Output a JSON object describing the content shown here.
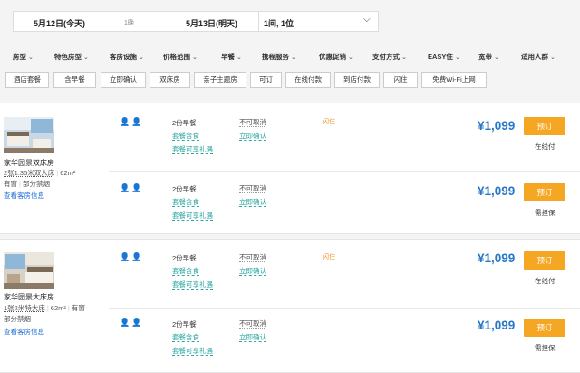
{
  "search": {
    "checkin": "5月12日(今天)",
    "nights": "1晚",
    "checkout": "5月13日(明天)",
    "rooms_guests": "1间, 1位"
  },
  "filters": [
    "房型",
    "特色房型",
    "客房设施",
    "价格范围",
    "早餐",
    "携程服务",
    "优惠促销",
    "支付方式",
    "EASY住",
    "宽带",
    "适用人群"
  ],
  "tags": [
    "酒店套餐",
    "含早餐",
    "立即确认",
    "双床房",
    "亲子主题房",
    "可订",
    "在线付款",
    "到店付款",
    "闪住",
    "免费Wi-Fi上网"
  ],
  "rooms": [
    {
      "name": "家华园景双床房",
      "line1": [
        "2张1.35米双人床",
        "62m²"
      ],
      "line2": [
        "有窗",
        "部分禁烟"
      ],
      "link": "查看客房信息",
      "plans": [
        {
          "guests": "2",
          "breakfast": "2份早餐",
          "pkg1": "套餐含食",
          "pkg2": "套餐可享礼遇",
          "cancel": "不可取消",
          "confirm": "立即确认",
          "flash": "闪住",
          "price": "¥1,099",
          "book": "预订",
          "pay": "在线付"
        },
        {
          "guests": "2",
          "breakfast": "2份早餐",
          "pkg1": "套餐含食",
          "pkg2": "套餐可享礼遇",
          "cancel": "不可取消",
          "confirm": "立即确认",
          "flash": "",
          "price": "¥1,099",
          "book": "预订",
          "pay": "需担保"
        }
      ]
    },
    {
      "name": "家华园景大床房",
      "line1": [
        "1张2米特大床",
        "62m²",
        "有窗"
      ],
      "line2": [
        "部分禁烟"
      ],
      "link": "查看客房信息",
      "plans": [
        {
          "guests": "2",
          "breakfast": "2份早餐",
          "pkg1": "套餐含食",
          "pkg2": "套餐可享礼遇",
          "cancel": "不可取消",
          "confirm": "立即确认",
          "flash": "闪住",
          "price": "¥1,099",
          "book": "预订",
          "pay": "在线付"
        },
        {
          "guests": "2",
          "breakfast": "2份早餐",
          "pkg1": "套餐含食",
          "pkg2": "套餐可享礼遇",
          "cancel": "不可取消",
          "confirm": "立即确认",
          "flash": "",
          "price": "¥1,099",
          "book": "预订",
          "pay": "需担保"
        }
      ]
    }
  ]
}
